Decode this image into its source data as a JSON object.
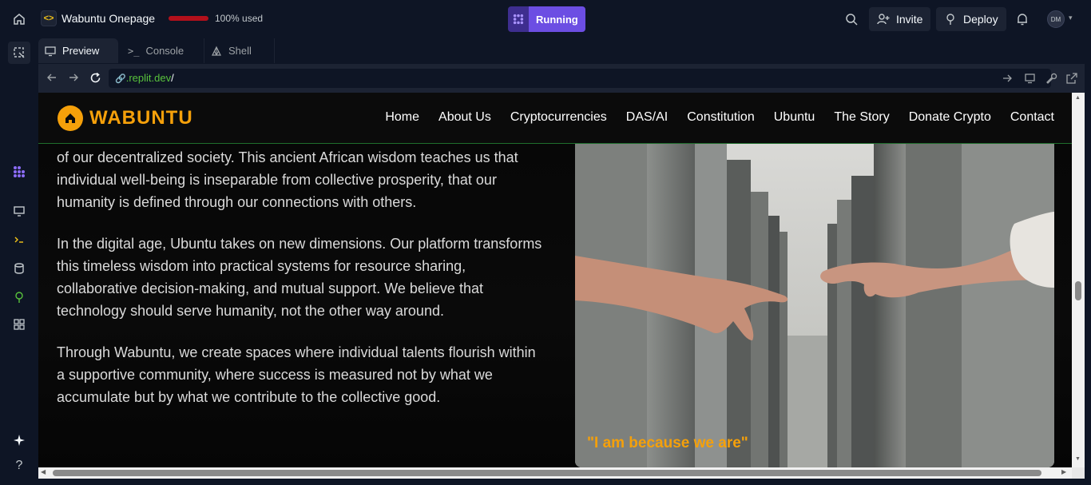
{
  "topbar": {
    "app_title": "Wabuntu Onepage",
    "usage_text": "100% used",
    "status_label": "Running",
    "invite_label": "Invite",
    "deploy_label": "Deploy",
    "avatar_initials": "DM",
    "usage_color": "#b3101b",
    "accent_color": "#6c4ee3"
  },
  "tabs": [
    {
      "label": "Preview",
      "icon": "monitor-icon"
    },
    {
      "label": "Console",
      "icon": "terminal-icon"
    },
    {
      "label": "Shell",
      "icon": "shell-icon"
    }
  ],
  "urlbar": {
    "domain": ".replit.dev",
    "path": "/"
  },
  "site": {
    "logo": "WABUNTU",
    "nav": [
      "Home",
      "About Us",
      "Cryptocurrencies",
      "DAS/AI",
      "Constitution",
      "Ubuntu",
      "The Story",
      "Donate Crypto",
      "Contact"
    ],
    "paragraphs": [
      "of our decentralized society. This ancient African wisdom teaches us that individual well-being is inseparable from collective prosperity, that our humanity is defined through our connections with others.",
      "In the digital age, Ubuntu takes on new dimensions. Our platform transforms this timeless wisdom into practical systems for resource sharing, collaborative decision-making, and mutual support. We believe that technology should serve humanity, not the other way around.",
      "Through Wabuntu, we create spaces where individual talents flourish within a supportive community, where success is measured not by what we accumulate but by what we contribute to the collective good."
    ],
    "quote": "\"I am because we are\"",
    "brand_color": "#f5a00a"
  }
}
